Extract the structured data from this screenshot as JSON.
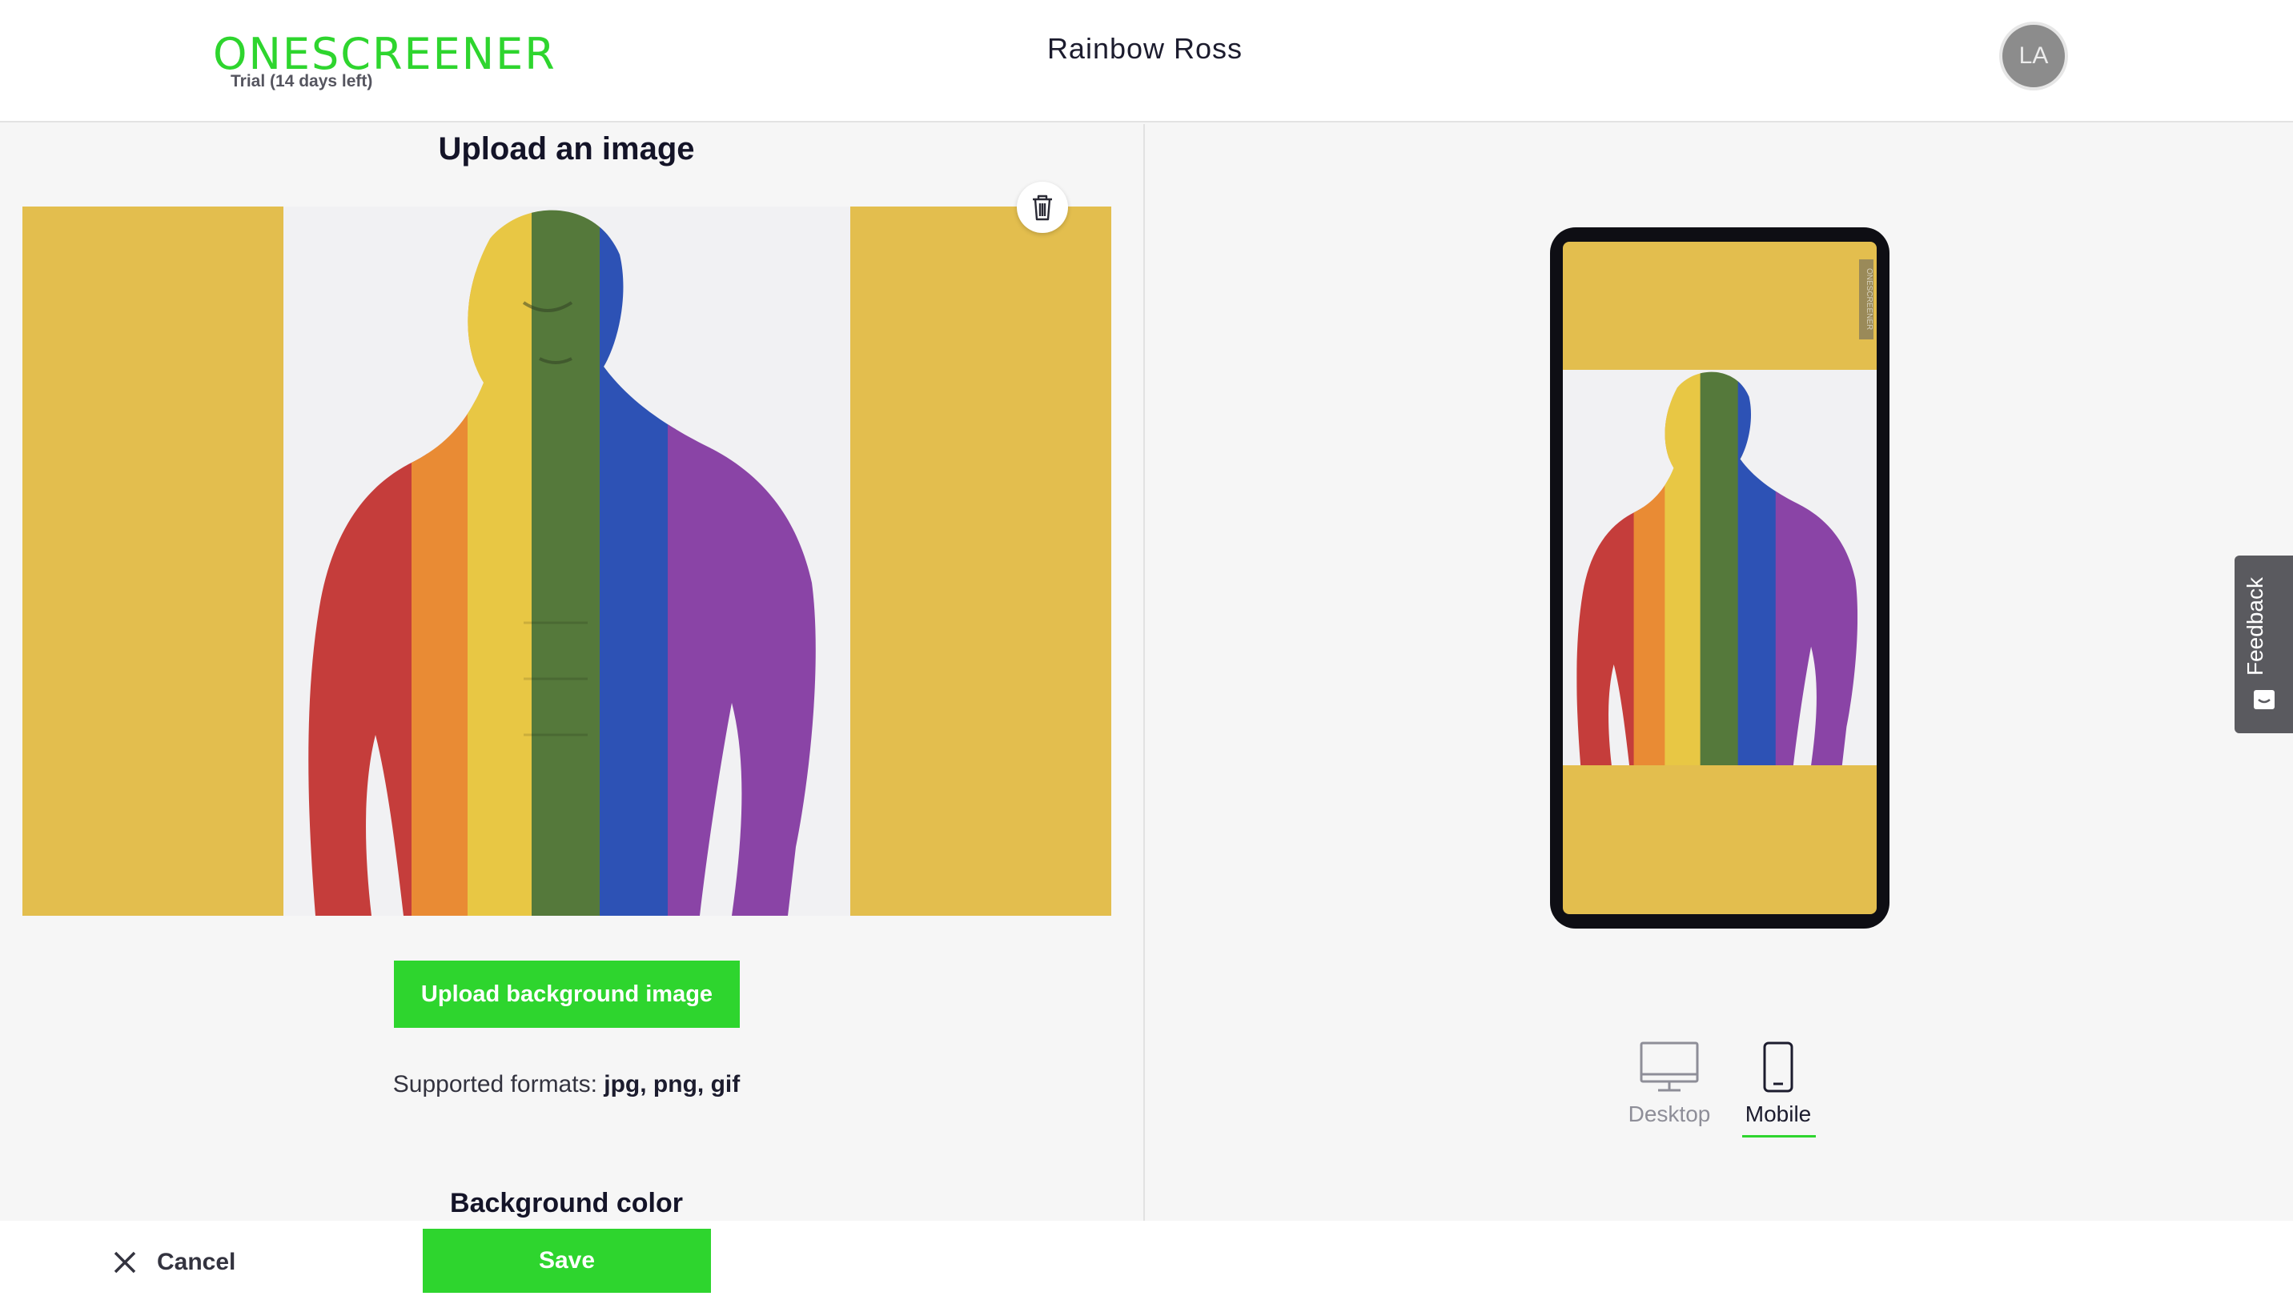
{
  "header": {
    "logo": "ONESCREENER",
    "trial_label": "Trial (14 days left)",
    "project_title": "Rainbow Ross",
    "avatar_initials": "LA"
  },
  "upload_section": {
    "title": "Upload an image",
    "upload_button_label": "Upload background image",
    "formats_prefix": "Supported formats:",
    "formats_list": "jpg, png, gif",
    "background_color_title": "Background color"
  },
  "preview": {
    "background_color": "#e3be4e",
    "phone_watermark": "ONESCREENER",
    "device_options": [
      {
        "label": "Desktop",
        "selected": false
      },
      {
        "label": "Mobile",
        "selected": true
      }
    ]
  },
  "feedback_tab": {
    "label": "Feedback"
  },
  "footer": {
    "cancel_label": "Cancel",
    "save_label": "Save"
  },
  "colors": {
    "brand_green": "#2ed52e",
    "background_yellow": "#e3be4e",
    "body_stripes": [
      "#c53d3b",
      "#e98b34",
      "#e8c744",
      "#55793b",
      "#2d52b5",
      "#8a44a6"
    ]
  }
}
